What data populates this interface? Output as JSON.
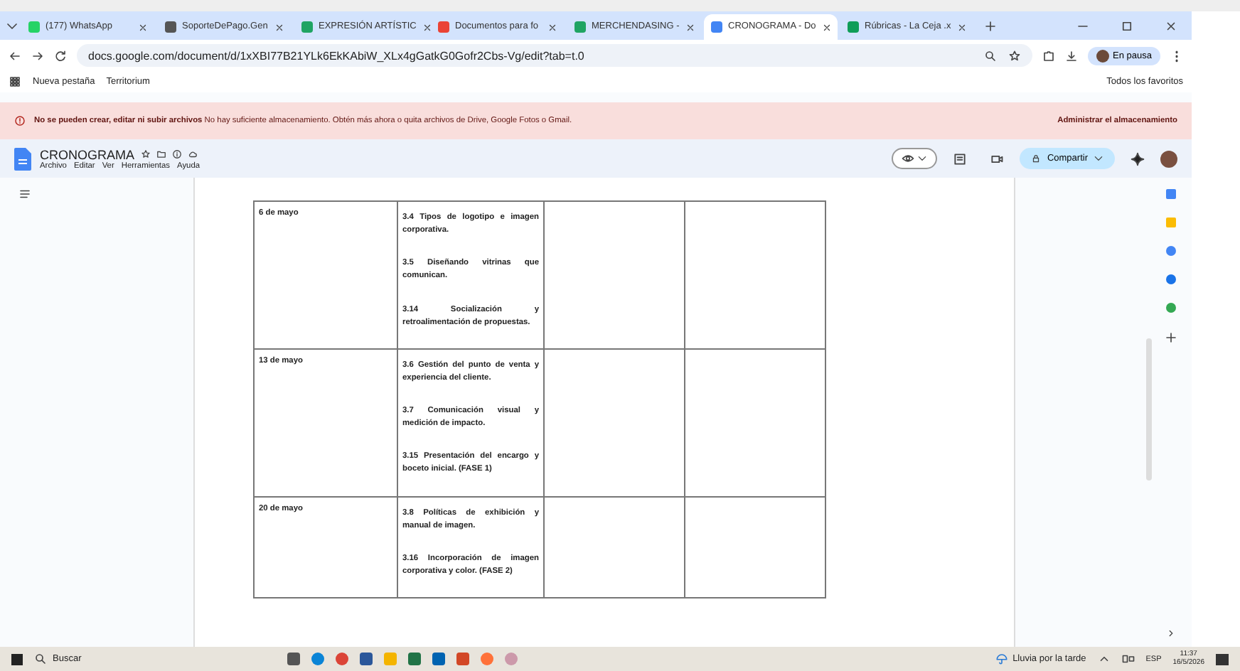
{
  "tabs": [
    {
      "label": "(177) WhatsApp",
      "selected": false
    },
    {
      "label": "SoporteDePago.Gen",
      "selected": false
    },
    {
      "label": "EXPRESIÓN ARTÍSTIC",
      "selected": false
    },
    {
      "label": "Documentos para fo",
      "selected": false
    },
    {
      "label": "MERCHENDASING - ",
      "selected": false
    },
    {
      "label": "CRONOGRAMA - Do",
      "selected": true
    },
    {
      "label": "Rúbricas - La Ceja .x",
      "selected": false
    }
  ],
  "address": "docs.google.com/document/d/1xXBI77B21YLk6EkKAbiW_XLx4gGatkG0Gofr2Cbs-Vg/edit?tab=t.0",
  "profile": "En pausa",
  "bookmarks": [
    "Nueva pestaña",
    "Territorium"
  ],
  "all_bookmarks": "Todos los favoritos",
  "banner": {
    "bold": "No se pueden crear, editar ni subir archivos",
    "text": "No hay suficiente almacenamiento. Obtén más ahora o quita archivos de Drive, Google Fotos o Gmail.",
    "action": "Administrar el almacenamiento"
  },
  "doc": {
    "title": "CRONOGRAMA",
    "menu": [
      "Archivo",
      "Editar",
      "Ver",
      "Herramientas",
      "Ayuda"
    ],
    "share": "Compartir"
  },
  "table": {
    "rows": [
      {
        "date": "6 de mayo",
        "topics": [
          "3.4 Tipos de logotipo e imagen corporativa.",
          "3.5 Diseñando vitrinas que comunican.",
          "3.14 Socialización y retroalimentación de propuestas."
        ]
      },
      {
        "date": "13 de mayo",
        "topics": [
          "3.6 Gestión del punto de venta y experiencia del cliente.",
          "3.7 Comunicación visual y medición de impacto.",
          "3.15 Presentación del encargo y boceto inicial. (FASE 1)"
        ]
      },
      {
        "date": "20 de mayo",
        "topics": [
          "3.8 Políticas de exhibición y manual de imagen.",
          "3.16 Incorporación de imagen corporativa y color. (FASE 2)"
        ]
      }
    ]
  },
  "taskbar": {
    "search": "Buscar",
    "weather": "Lluvia por la tarde",
    "lang": "ESP",
    "time": "11:37",
    "date": "16/5/2026"
  }
}
